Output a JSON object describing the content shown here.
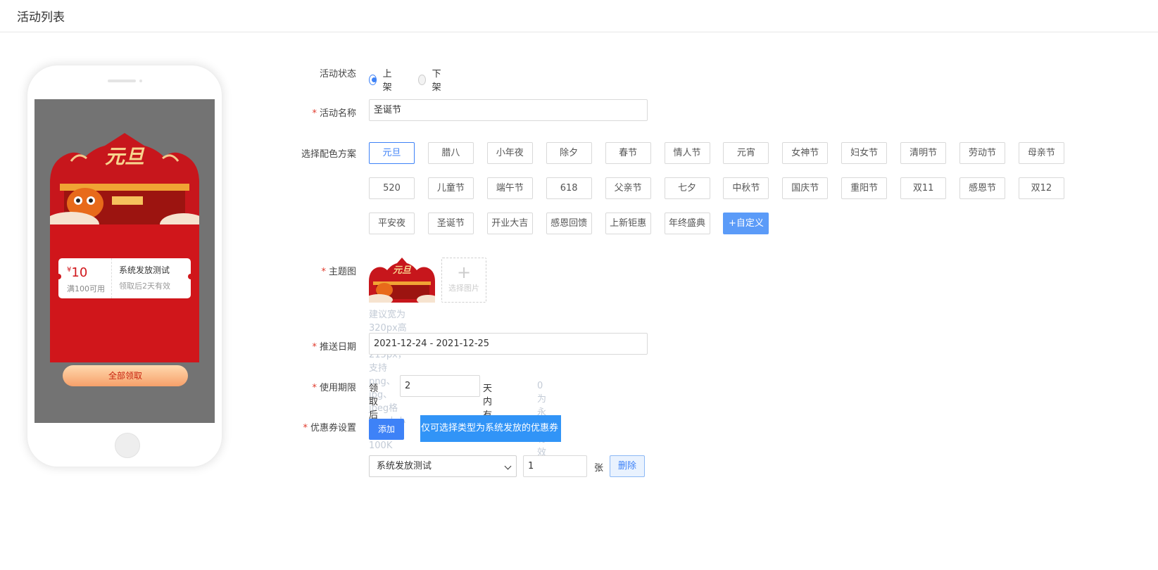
{
  "header": {
    "title": "活动列表"
  },
  "preview": {
    "poster_title": "元旦",
    "coupon": {
      "currency": "¥",
      "amount": "10",
      "condition": "满100可用",
      "name": "系统发放测试",
      "validity": "领取后2天有效"
    },
    "get_all_label": "全部领取",
    "colors": {
      "festive_red": "#d0161b",
      "button_gradient": "#f6a06a"
    }
  },
  "form": {
    "status": {
      "label": "活动状态",
      "options": [
        "上架",
        "下架"
      ],
      "selected": "上架"
    },
    "name": {
      "label": "活动名称",
      "value": "圣诞节"
    },
    "scheme": {
      "label": "选择配色方案",
      "options": [
        "元旦",
        "腊八",
        "小年夜",
        "除夕",
        "春节",
        "情人节",
        "元宵",
        "女神节",
        "妇女节",
        "清明节",
        "劳动节",
        "母亲节",
        "520",
        "儿童节",
        "端午节",
        "618",
        "父亲节",
        "七夕",
        "中秋节",
        "国庆节",
        "重阳节",
        "双11",
        "感恩节",
        "双12",
        "平安夜",
        "圣诞节",
        "开业大吉",
        "感恩回馈",
        "上新钜惠",
        "年终盛典",
        "+自定义"
      ],
      "selected": "元旦"
    },
    "theme": {
      "label": "主题图",
      "upload_label": "选择图片",
      "hint": "建议宽为320px高为215px，支持png、jpg、jpeg格式，大小不超过100K"
    },
    "date": {
      "label": "推送日期",
      "value": "2021-12-24 - 2021-12-25"
    },
    "validity": {
      "label": "使用期限",
      "prefix": "领取后",
      "value": "2",
      "suffix": "天内有效",
      "hint": "0为永久有效"
    },
    "coupon_setting": {
      "label": "优惠券设置",
      "add_label": "添加",
      "notice": "仅可选择类型为系统发放的优惠券",
      "select_value": "系统发放测试",
      "qty": "1",
      "unit": "张",
      "delete_label": "删除"
    },
    "accent": "#3e82f7"
  }
}
